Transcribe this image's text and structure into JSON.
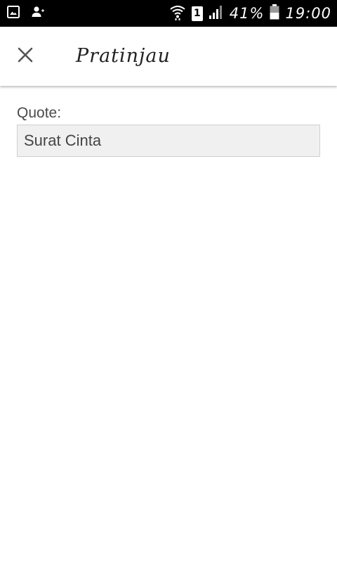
{
  "status_bar": {
    "battery_percent": "41%",
    "time": "19:00",
    "sim_slot": "1",
    "icons": [
      "gallery-icon",
      "person-add-icon",
      "wifi-icon",
      "sim-icon",
      "signal-icon",
      "battery-icon"
    ]
  },
  "toolbar": {
    "close_icon": "close-icon",
    "title": "Pratinjau"
  },
  "form": {
    "quote_label": "Quote:",
    "quote_value": "Surat Cinta"
  },
  "colors": {
    "status_bar_bg": "#000000",
    "toolbar_bg": "#ffffff",
    "field_bg": "#f0f0f0",
    "text": "#4a4a4a"
  }
}
